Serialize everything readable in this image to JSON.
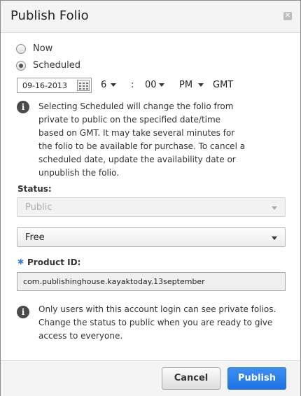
{
  "dialog": {
    "title": "Publish Folio",
    "close_icon": "close-icon"
  },
  "schedule": {
    "options": [
      {
        "label": "Now",
        "selected": false
      },
      {
        "label": "Scheduled",
        "selected": true
      }
    ],
    "date": "09-16-2013",
    "hour": "6",
    "separator": ":",
    "minute": "00",
    "ampm": "PM",
    "timezone": "GMT"
  },
  "info1": {
    "lines": [
      "Selecting Scheduled will change the folio from",
      "private to public on the specified date/time",
      "based on GMT. It may take several minutes for",
      "the folio to be available for purchase. To cancel a",
      "scheduled date, update the availability date or",
      "unpublish the folio."
    ]
  },
  "status": {
    "label": "Status:",
    "value": "Public",
    "disabled": true
  },
  "price": {
    "value": "Free"
  },
  "product": {
    "required_marker": "✱",
    "label": "Product ID:",
    "value": "com.publishinghouse.kayaktoday.13september"
  },
  "info2": {
    "lines": [
      "Only users with this account login can see private folios.",
      "Change the status to public when you are ready to give",
      "access to everyone."
    ]
  },
  "buttons": {
    "cancel": "Cancel",
    "publish": "Publish"
  },
  "colors": {
    "primary": "#2a80ee",
    "required": "#3b7fd4"
  }
}
